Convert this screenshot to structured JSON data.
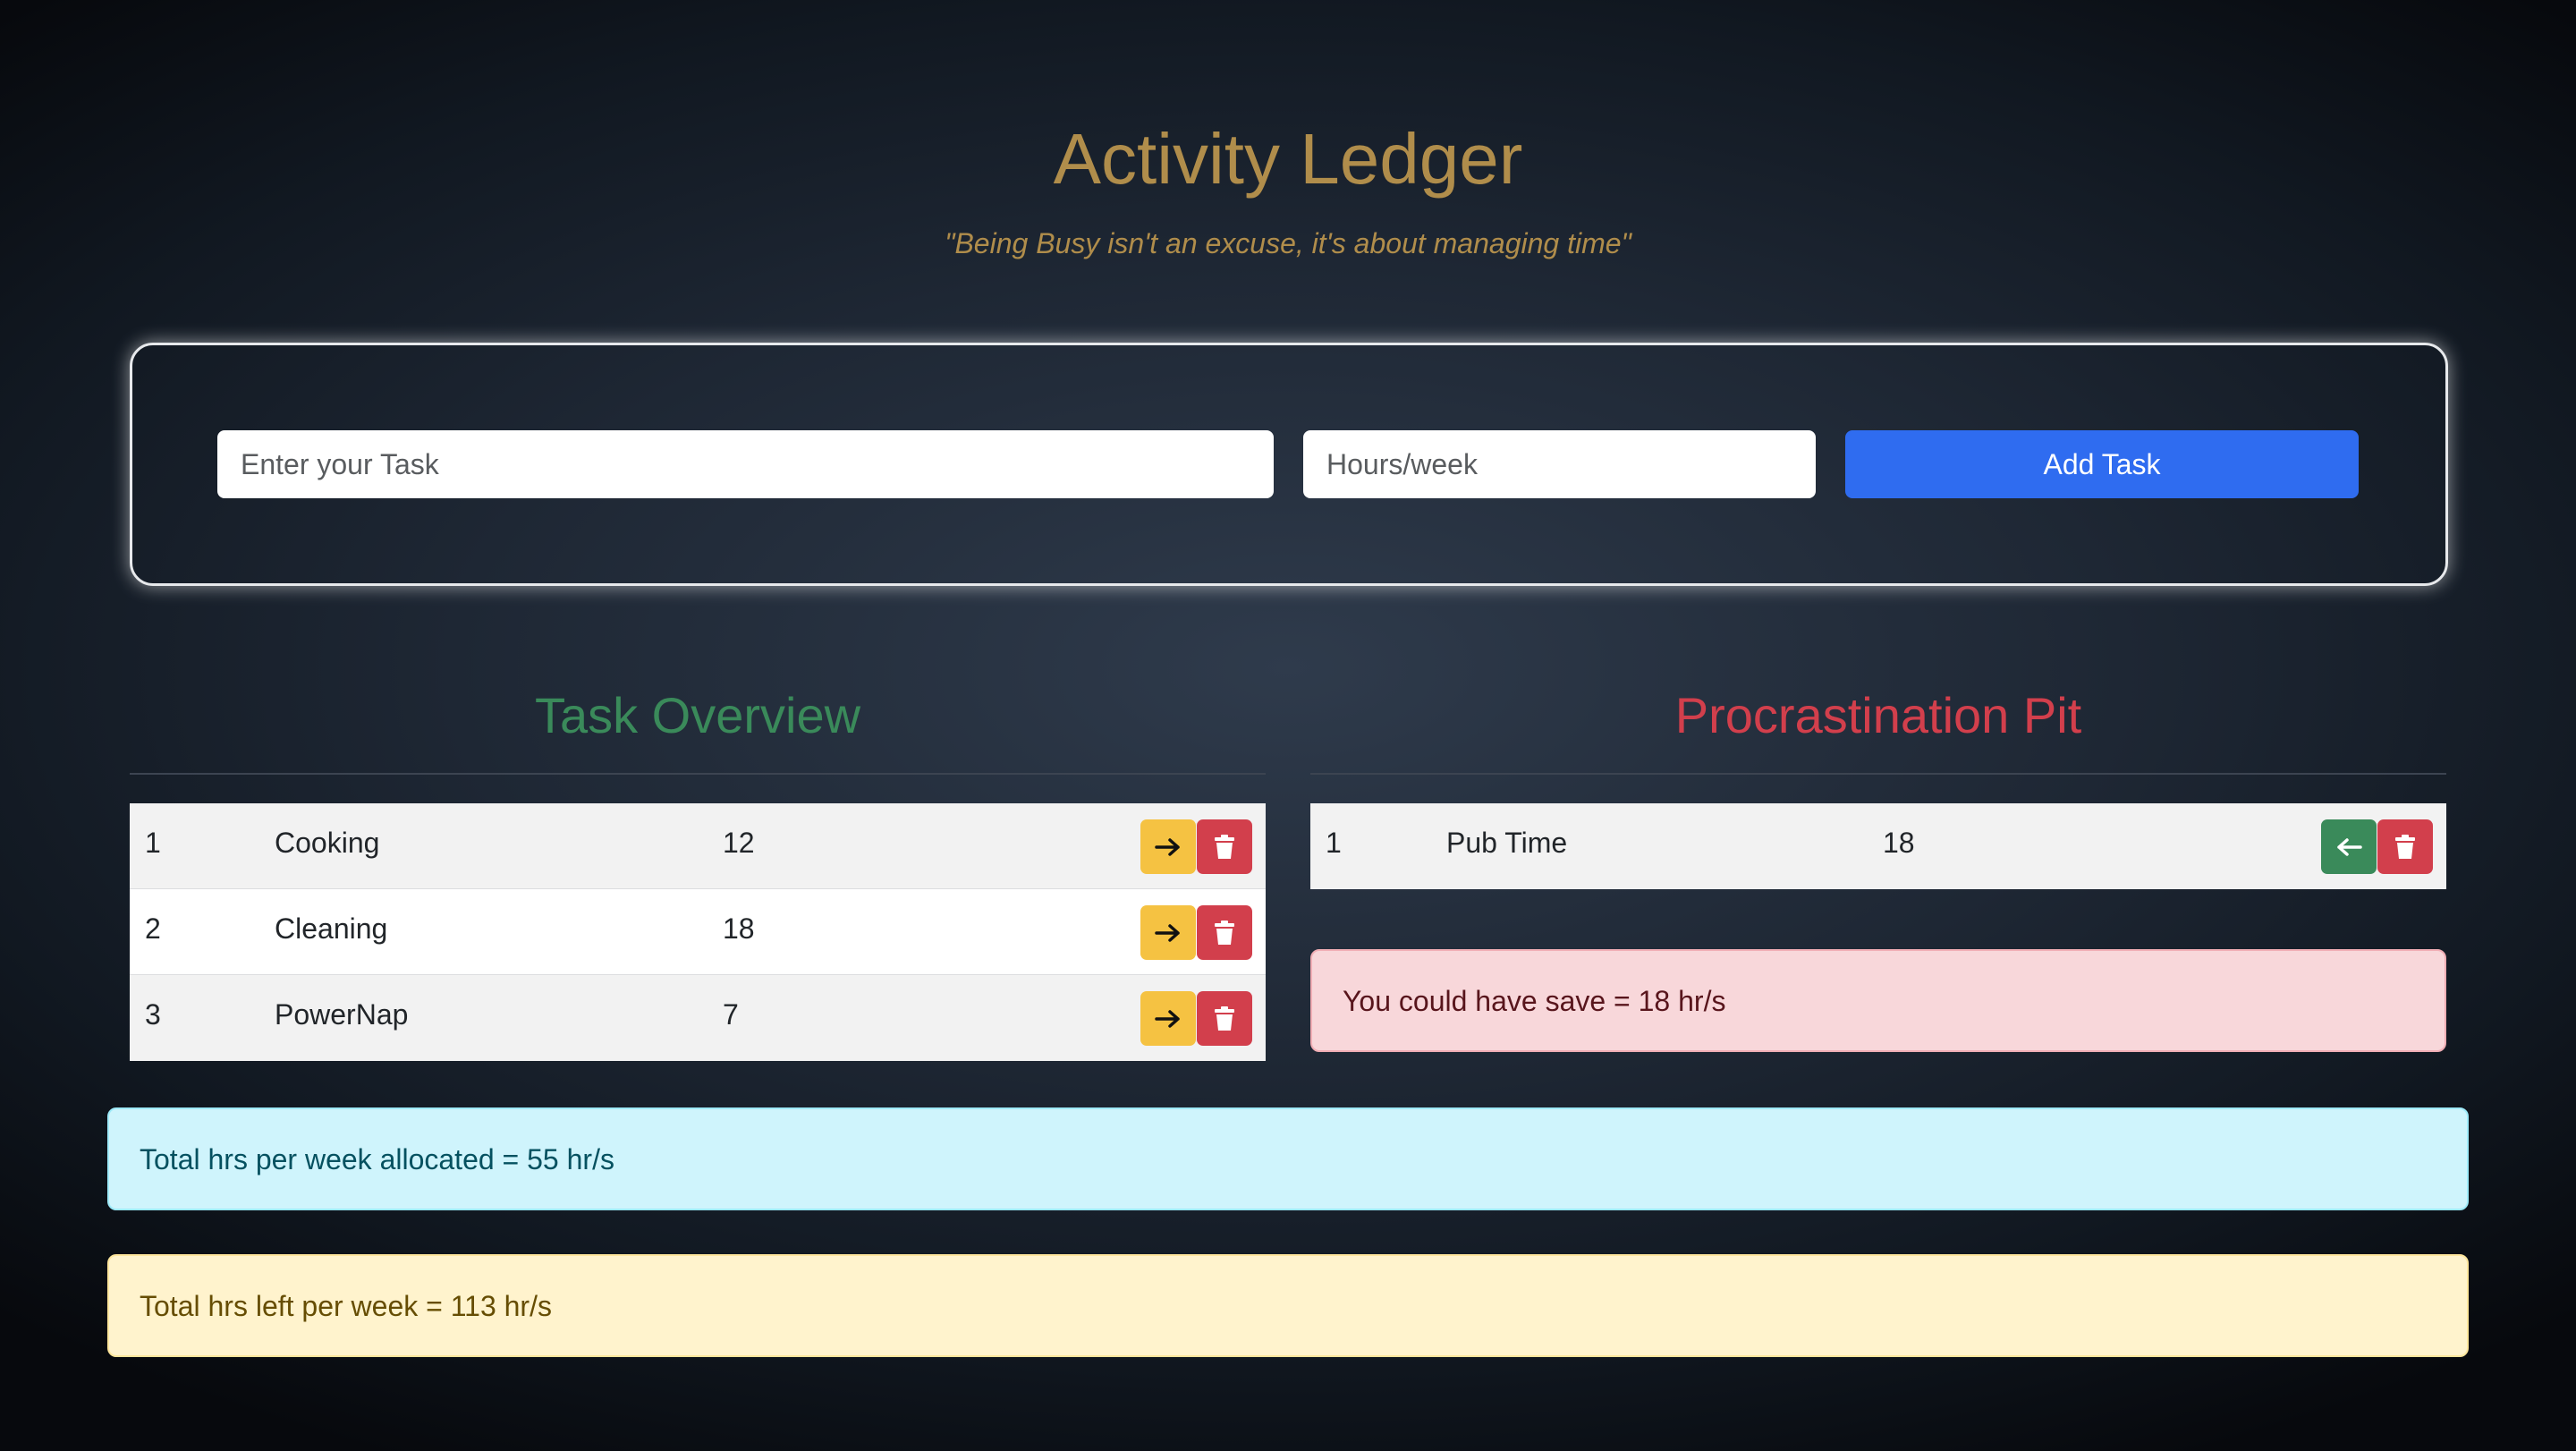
{
  "app": {
    "title": "Activity Ledger",
    "tagline": "\"Being Busy isn't an excuse, it's about managing time\""
  },
  "form": {
    "task_placeholder": "Enter your Task",
    "task_value": "",
    "hours_placeholder": "Hours/week",
    "hours_value": "",
    "add_button_label": "Add Task"
  },
  "task_overview": {
    "heading": "Task Overview",
    "rows": [
      {
        "index": "1",
        "name": "Cooking",
        "hours": "12"
      },
      {
        "index": "2",
        "name": "Cleaning",
        "hours": "18"
      },
      {
        "index": "3",
        "name": "PowerNap",
        "hours": "7"
      }
    ],
    "move_icon": "arrow-right-icon",
    "delete_icon": "trash-icon"
  },
  "procrastination_pit": {
    "heading": "Procrastination Pit",
    "rows": [
      {
        "index": "1",
        "name": "Pub Time",
        "hours": "18"
      }
    ],
    "restore_icon": "arrow-left-icon",
    "delete_icon": "trash-icon",
    "savings_text": "You could have save = 18 hr/s"
  },
  "summary": {
    "allocated_text": "Total hrs per week allocated = 55 hr/s",
    "left_text": "Total hrs left per week = 113 hr/s"
  },
  "colors": {
    "title_gold": "#b08d4b",
    "overview_green": "#3a8a5a",
    "pit_red": "#d23f4c",
    "primary_blue": "#2f6cf0",
    "warning_yellow": "#f5c242"
  }
}
